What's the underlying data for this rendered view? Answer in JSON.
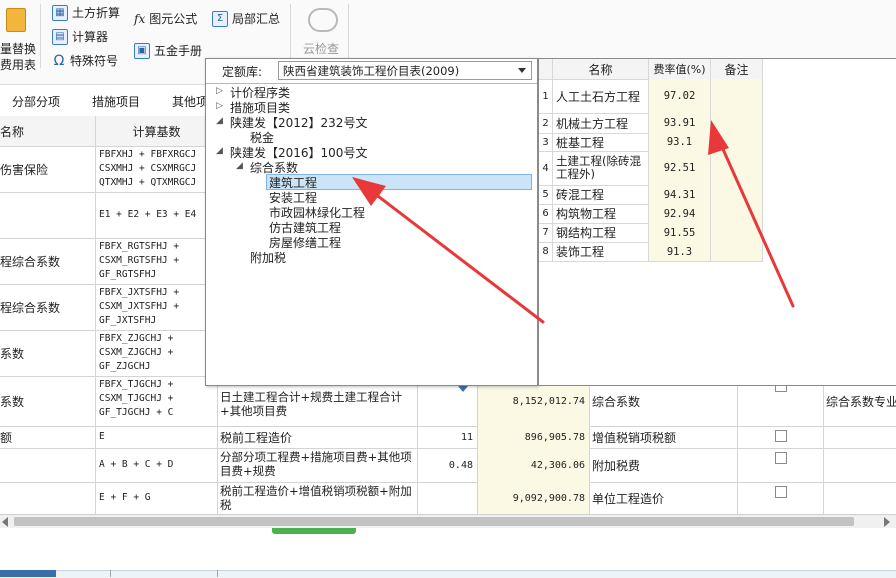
{
  "ribbon": {
    "left_btn_line1": "量替换",
    "left_btn_line2": "费用表",
    "earthwork": "土方折算",
    "calculator": "计算器",
    "special_symbol": "特殊符号",
    "element_formula": "图元公式",
    "hardware_manual": "五金手册",
    "partial_summary": "局部汇总",
    "cloud_check": "云检查"
  },
  "tabs": [
    "分部分项",
    "措施项目",
    "其他项"
  ],
  "grid": {
    "col_name": "名称",
    "col_base": "计算基数",
    "rows": [
      {
        "name": "伤害保险",
        "base": "FBFXHJ + FBFXRGCJ\nCSXMHJ + CSXMRGCJ\nQTXMHJ + QTXMRGCJ"
      },
      {
        "name": "",
        "base": "E1 + E2 + E3 + E4"
      },
      {
        "name": "程综合系数",
        "base": "FBFX_RGTSFHJ +\nCSXM_RGTSFHJ +\nGF_RGTSFHJ"
      },
      {
        "name": "程综合系数",
        "base": "FBFX_JXTSFHJ +\nCSXM_JXTSFHJ +\nGF_JXTSFHJ"
      },
      {
        "name": "系数",
        "base": "FBFX_ZJGCHJ +\nCSXM_ZJGCHJ +\nGF_ZJGCHJ"
      },
      {
        "name": "系数",
        "base": "FBFX_TJGCHJ +\nCSXM_TJGCHJ +\nGF_TJGCHJ + C",
        "desc": "日土建工程合计+规费土建工程合计\n+其他项目费",
        "amount": "8,152,012.74",
        "type": "综合系数",
        "extra": "综合系数专业"
      },
      {
        "name": "额",
        "base": "E",
        "desc": "税前工程造价",
        "rate": "11",
        "amount": "896,905.78",
        "type": "增值税销项税额"
      },
      {
        "name": "",
        "base": "A + B + C + D",
        "desc": "分部分项工程费+措施项目费+其他项\n目费+规费",
        "rate": "0.48",
        "amount": "42,306.06",
        "type": "附加税费"
      },
      {
        "name": "",
        "base": "E + F + G",
        "desc": "税前工程造价+增值税销项税额+附加\n税",
        "amount": "9,092,900.78",
        "type": "单位工程造价"
      }
    ]
  },
  "quota_library": {
    "label": "定额库:",
    "selected": "陕西省建筑装饰工程价目表(2009)",
    "tree": [
      {
        "label": "计价程序类",
        "level": 0,
        "toggle": "▷"
      },
      {
        "label": "措施项目类",
        "level": 0,
        "toggle": "▷"
      },
      {
        "label": "陕建发【2012】232号文",
        "level": 0,
        "toggle": "◢"
      },
      {
        "label": "税金",
        "level": 1,
        "toggle": ""
      },
      {
        "label": "陕建发【2016】100号文",
        "level": 0,
        "toggle": "◢"
      },
      {
        "label": "综合系数",
        "level": 1,
        "toggle": "◢"
      },
      {
        "label": "建筑工程",
        "level": 2,
        "toggle": "",
        "selected": true
      },
      {
        "label": "安装工程",
        "level": 2,
        "toggle": ""
      },
      {
        "label": "市政园林绿化工程",
        "level": 2,
        "toggle": ""
      },
      {
        "label": "仿古建筑工程",
        "level": 2,
        "toggle": ""
      },
      {
        "label": "房屋修缮工程",
        "level": 2,
        "toggle": ""
      },
      {
        "label": "附加税",
        "level": 0,
        "toggle": ""
      }
    ]
  },
  "rate_table": {
    "col_name": "名称",
    "col_rate": "费率值(%)",
    "col_note": "备注",
    "rows": [
      {
        "idx": "1",
        "name": "人工土石方工程",
        "rate": "97.02"
      },
      {
        "idx": "2",
        "name": "机械土方工程",
        "rate": "93.91"
      },
      {
        "idx": "3",
        "name": "桩基工程",
        "rate": "93.1"
      },
      {
        "idx": "4",
        "name": "土建工程(除砖混\n工程外)",
        "rate": "92.51"
      },
      {
        "idx": "5",
        "name": "砖混工程",
        "rate": "94.31"
      },
      {
        "idx": "6",
        "name": "构筑物工程",
        "rate": "92.94"
      },
      {
        "idx": "7",
        "name": "钢结构工程",
        "rate": "91.55"
      },
      {
        "idx": "8",
        "name": "装饰工程",
        "rate": "91.3"
      }
    ]
  },
  "colors": {
    "arrow": "#e8383a",
    "yellow_cell": "#fbf9e4",
    "selection": "#cce4f7"
  }
}
